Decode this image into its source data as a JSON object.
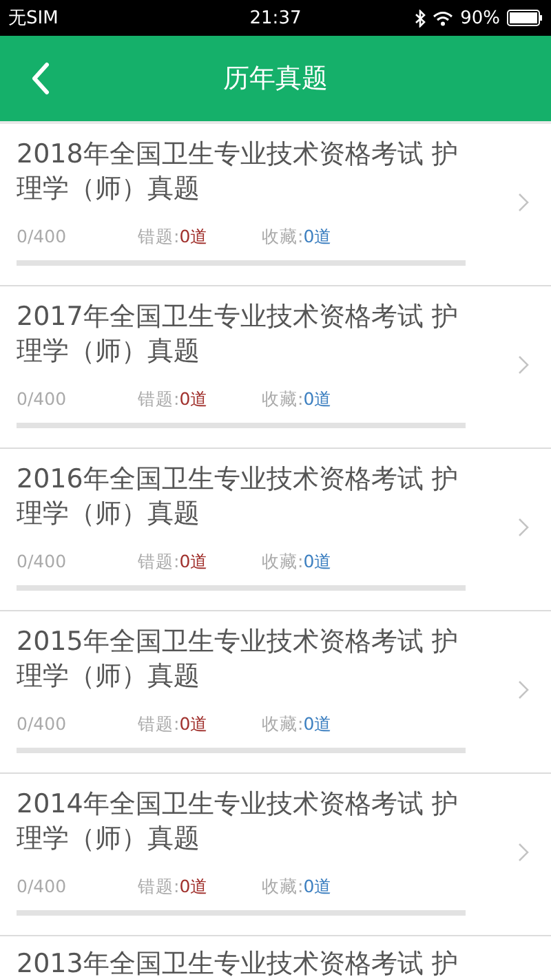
{
  "status_bar": {
    "carrier": "无SIM",
    "time": "21:37",
    "battery": "90%"
  },
  "header": {
    "title": "历年真题"
  },
  "papers": [
    {
      "title": "2018年全国卫生专业技术资格考试 护理学（师）真题",
      "progress": "0/400",
      "wrong_label": "错题:",
      "wrong": "0道",
      "fav_label": "收藏:",
      "fav": "0道",
      "level": 0
    },
    {
      "title": "2017年全国卫生专业技术资格考试 护理学（师）真题",
      "progress": "0/400",
      "wrong_label": "错题:",
      "wrong": "0道",
      "fav_label": "收藏:",
      "fav": "0道",
      "level": 0
    },
    {
      "title": "2016年全国卫生专业技术资格考试 护理学（师）真题",
      "progress": "0/400",
      "wrong_label": "错题:",
      "wrong": "0道",
      "fav_label": "收藏:",
      "fav": "0道",
      "level": 0
    },
    {
      "title": "2015年全国卫生专业技术资格考试 护理学（师）真题",
      "progress": "0/400",
      "wrong_label": "错题:",
      "wrong": "0道",
      "fav_label": "收藏:",
      "fav": "0道",
      "level": 0
    },
    {
      "title": "2014年全国卫生专业技术资格考试 护理学（师）真题",
      "progress": "0/400",
      "wrong_label": "错题:",
      "wrong": "0道",
      "fav_label": "收藏:",
      "fav": "0道",
      "level": 0
    }
  ],
  "partial_paper": {
    "title": "2013年全国卫生专业技术资格考试 护"
  }
}
